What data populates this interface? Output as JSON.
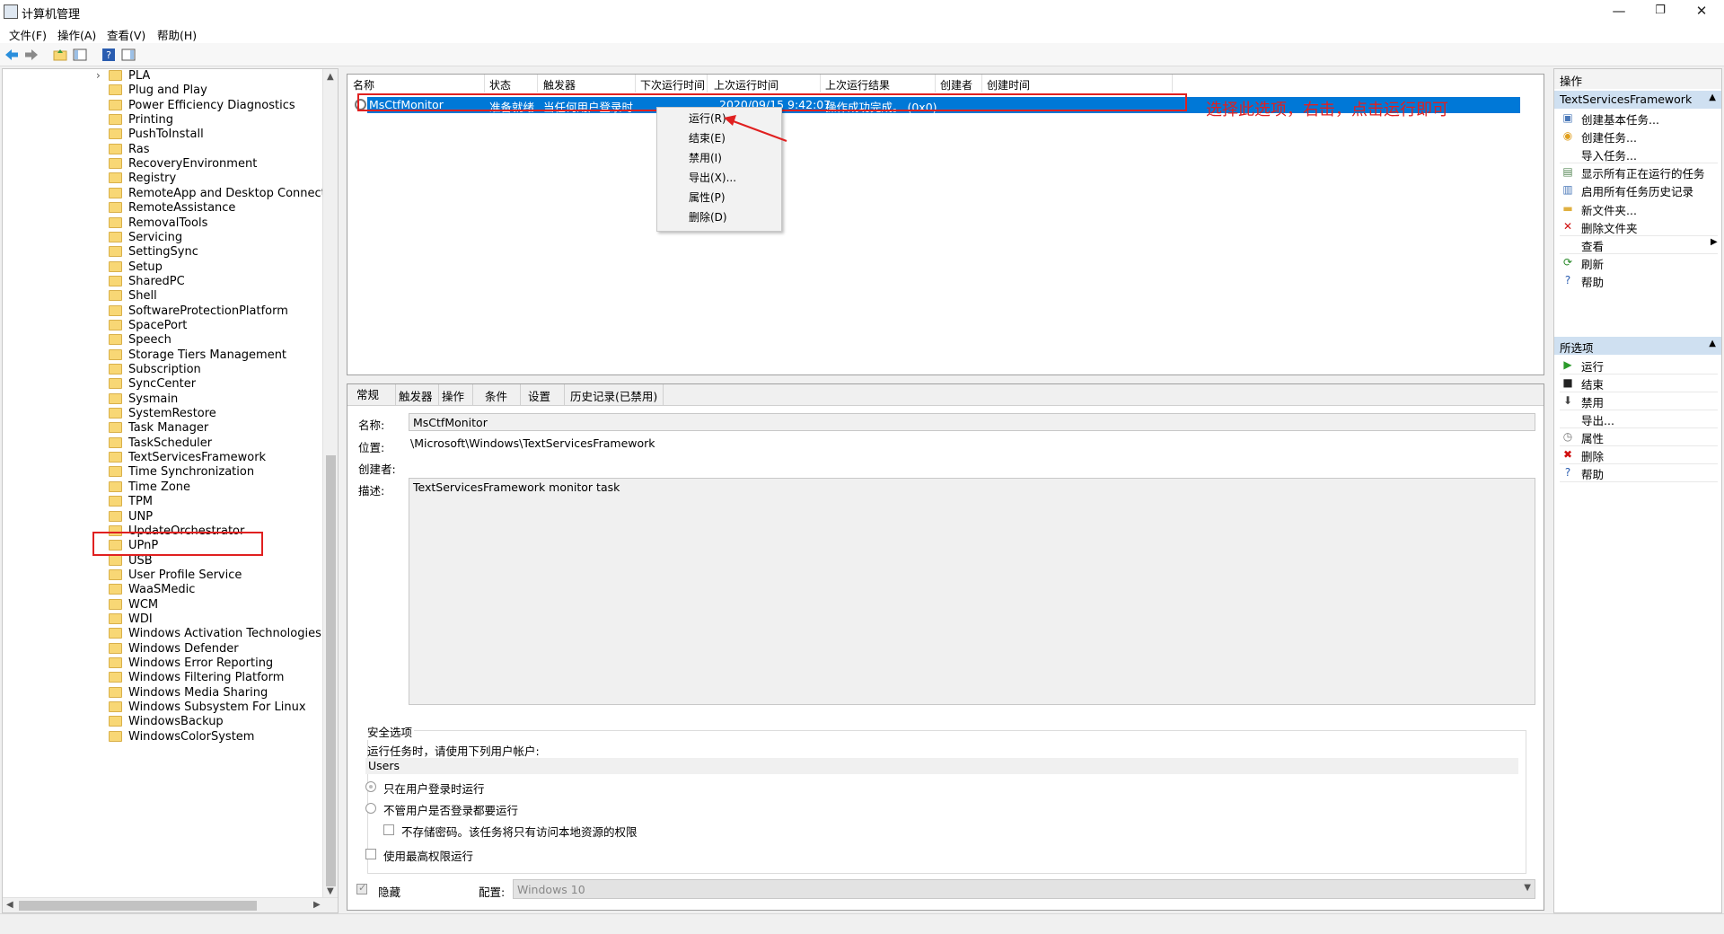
{
  "window": {
    "title": "计算机管理"
  },
  "menu": [
    "文件(F)",
    "操作(A)",
    "查看(V)",
    "帮助(H)"
  ],
  "tree": {
    "items": [
      "PLA",
      "Plug and Play",
      "Power Efficiency Diagnostics",
      "Printing",
      "PushToInstall",
      "Ras",
      "RecoveryEnvironment",
      "Registry",
      "RemoteApp and Desktop Connections",
      "RemoteAssistance",
      "RemovalTools",
      "Servicing",
      "SettingSync",
      "Setup",
      "SharedPC",
      "Shell",
      "SoftwareProtectionPlatform",
      "SpacePort",
      "Speech",
      "Storage Tiers Management",
      "Subscription",
      "SyncCenter",
      "Sysmain",
      "SystemRestore",
      "Task Manager",
      "TaskScheduler",
      "TextServicesFramework",
      "Time Synchronization",
      "Time Zone",
      "TPM",
      "UNP",
      "UpdateOrchestrator",
      "UPnP",
      "USB",
      "User Profile Service",
      "WaaSMedic",
      "WCM",
      "WDI",
      "Windows Activation Technologies",
      "Windows Defender",
      "Windows Error Reporting",
      "Windows Filtering Platform",
      "Windows Media Sharing",
      "Windows Subsystem For Linux",
      "WindowsBackup",
      "WindowsColorSystem"
    ],
    "selected": "TextServicesFramework"
  },
  "tasklist": {
    "columns": [
      "名称",
      "状态",
      "触发器",
      "下次运行时间",
      "上次运行时间",
      "上次运行结果",
      "创建者",
      "创建时间"
    ],
    "row": {
      "name": "MsCtfMonitor",
      "status": "准备就绪",
      "trigger": "当任何用户登录时",
      "last_run": "2020/09/15 9:42:07",
      "last_result": "操作成功完成。 (0x0)"
    }
  },
  "context_menu": [
    "运行(R)",
    "结束(E)",
    "禁用(I)",
    "导出(X)...",
    "属性(P)",
    "删除(D)"
  ],
  "annotation": "选择此选项，右击，点击运行即可",
  "details": {
    "tabs": [
      "常规",
      "触发器",
      "操作",
      "条件",
      "设置",
      "历史记录(已禁用)"
    ],
    "name_label": "名称:",
    "name_value": "MsCtfMonitor",
    "location_label": "位置:",
    "location_value": "\\Microsoft\\Windows\\TextServicesFramework",
    "author_label": "创建者:",
    "description_label": "描述:",
    "description_value": "TextServicesFramework monitor task",
    "security_group": "安全选项",
    "run_as_label": "运行任务时，请使用下列用户帐户:",
    "run_as_user": "Users",
    "opt_logged_on": "只在用户登录时运行",
    "opt_whether_logged": "不管用户是否登录都要运行",
    "opt_no_password": "不存储密码。该任务将只有访问本地资源的权限",
    "opt_highest": "使用最高权限运行",
    "hidden_label": "隐藏",
    "config_label": "配置:",
    "config_value": "Windows 10"
  },
  "actions": {
    "header": "操作",
    "section1": "TextServicesFramework",
    "items1": [
      "创建基本任务...",
      "创建任务...",
      "导入任务...",
      "显示所有正在运行的任务",
      "启用所有任务历史记录",
      "新文件夹...",
      "删除文件夹",
      "查看",
      "刷新",
      "帮助"
    ],
    "section2": "所选项",
    "items2": [
      "运行",
      "结束",
      "禁用",
      "导出...",
      "属性",
      "删除",
      "帮助"
    ]
  }
}
